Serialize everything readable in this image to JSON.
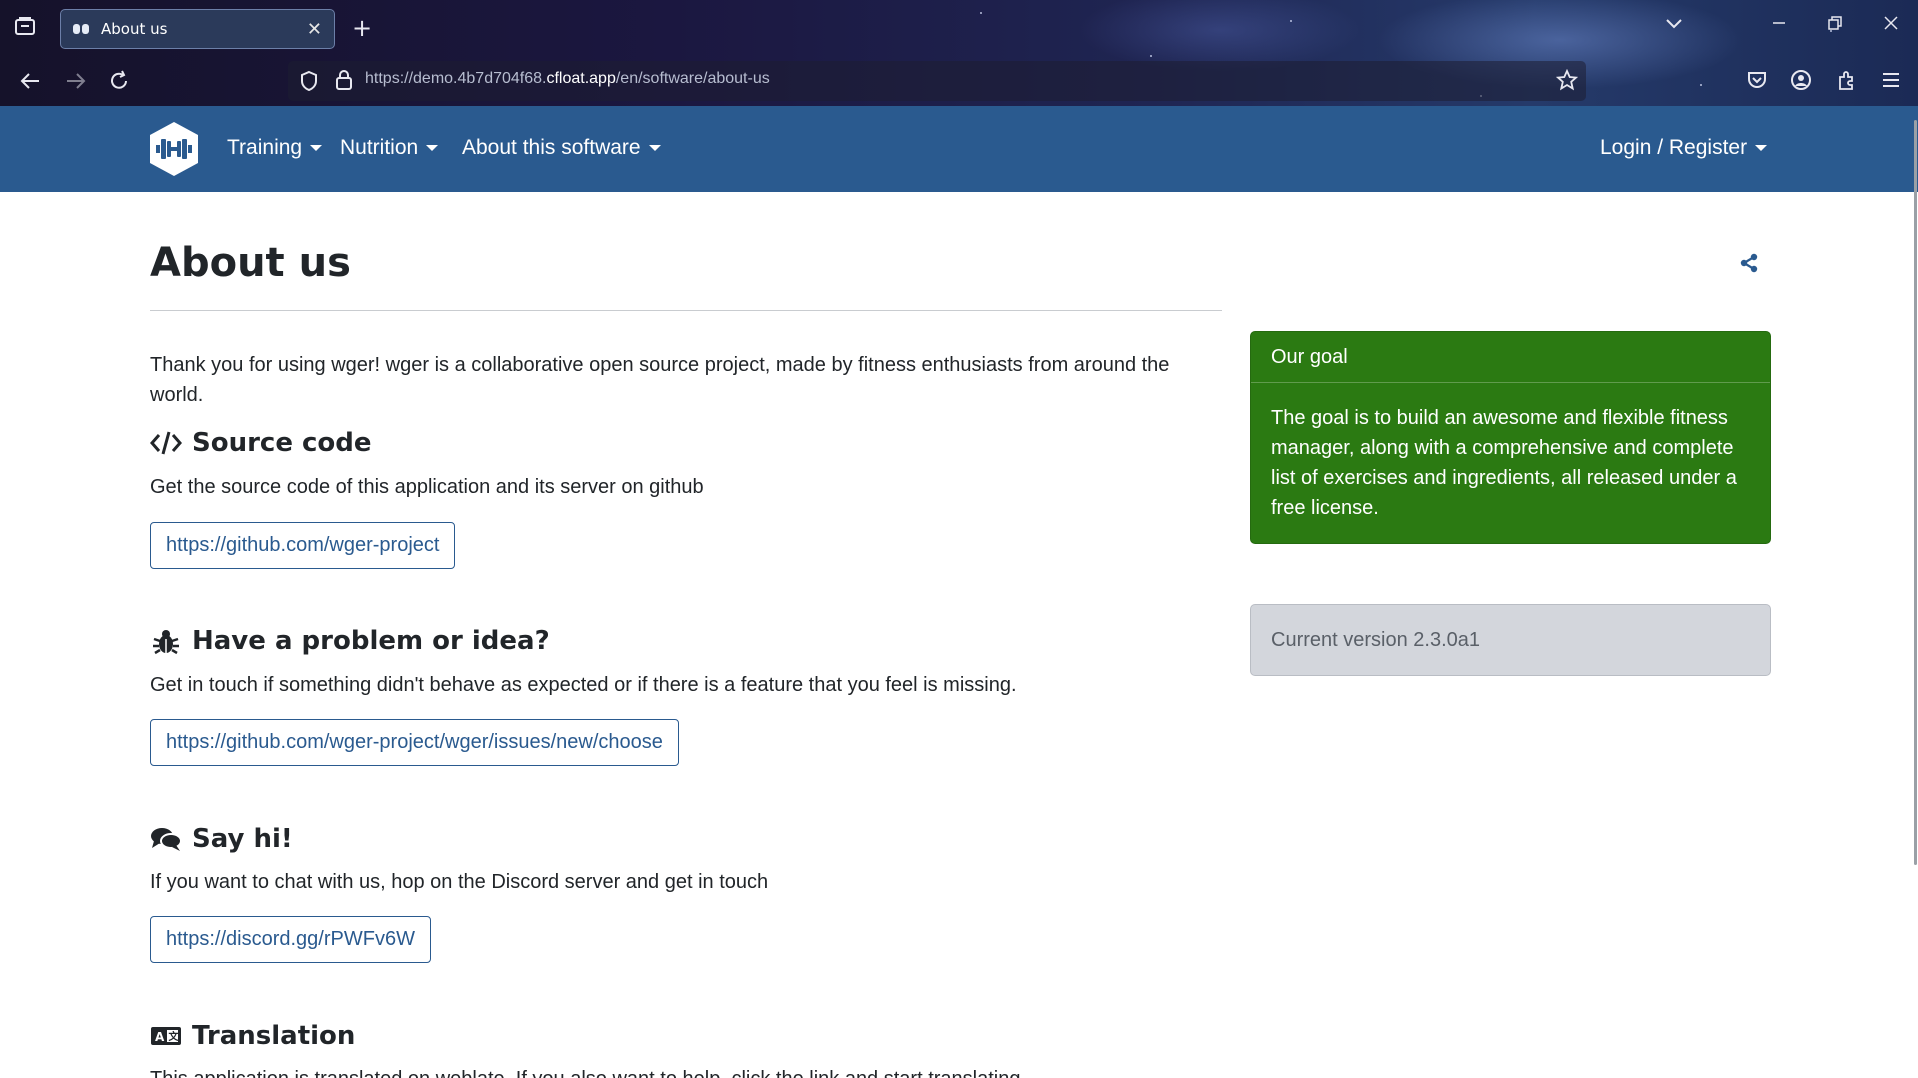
{
  "browser": {
    "tab_title": "About us",
    "url_prefix": "https://demo.4b7d704f68.",
    "url_host": "cfloat.app",
    "url_path": "/en/software/about-us"
  },
  "nav": {
    "items": [
      {
        "label": "Training"
      },
      {
        "label": "Nutrition"
      },
      {
        "label": "About this software"
      }
    ],
    "login": "Login / Register"
  },
  "page": {
    "title": "About us",
    "intro_line1": "Thank you for using wger! wger is a collaborative open source project, made by fitness enthusiasts from around the",
    "intro_line2": "world.",
    "sections": [
      {
        "heading": "Source code",
        "icon": "code-icon",
        "text": "Get the source code of this application and its server on github",
        "link": "https://github.com/wger-project"
      },
      {
        "heading": "Have a problem or idea?",
        "icon": "bug-icon",
        "text": "Get in touch if something didn't behave as expected or if there is a feature that you feel is missing.",
        "link": "https://github.com/wger-project/wger/issues/new/choose"
      },
      {
        "heading": "Say hi!",
        "icon": "comments-icon",
        "text": "If you want to chat with us, hop on the Discord server and get in touch",
        "link": "https://discord.gg/rPWFv6W"
      },
      {
        "heading": "Translation",
        "icon": "language-icon",
        "text": "This application is translated on weblate. If you also want to help, click the link and start translating"
      }
    ]
  },
  "sidebar": {
    "goal_title": "Our goal",
    "goal_line1": "The goal is to build an awesome and flexible fitness",
    "goal_line2": "manager, along with a comprehensive and complete",
    "goal_line3": "list of exercises and ingredients, all released under a",
    "goal_line4": "free license.",
    "version": "Current version 2.3.0a1"
  },
  "colors": {
    "navbar": "#2a5a8f",
    "goal_card": "#2b7a12",
    "version_card": "#d3d6dc"
  }
}
